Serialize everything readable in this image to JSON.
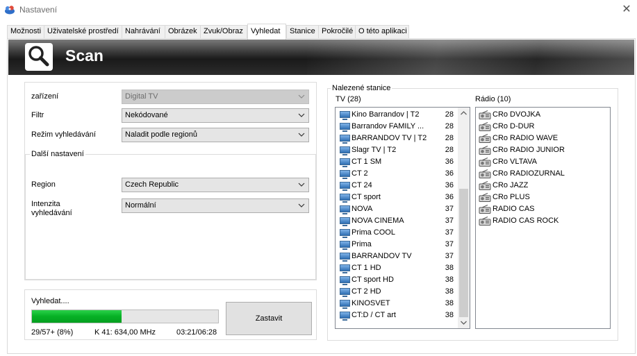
{
  "window": {
    "title": "Nastavení"
  },
  "tabs": [
    "Možnosti",
    "Uživatelské prostředí",
    "Nahrávání",
    "Obrázek",
    "Zvuk/Obraz",
    "Vyhledat",
    "Stanice",
    "Pokročilé",
    "O této aplikaci"
  ],
  "active_tab": "Vyhledat",
  "banner": {
    "title": "Scan",
    "icon": "search-icon"
  },
  "settings": {
    "device_label": "zařízení",
    "device_value": "Digital TV",
    "filter_label": "Filtr",
    "filter_value": "Nekódované",
    "mode_label": "Režim vyhledávání",
    "mode_value": "Naladit podle regionů"
  },
  "more_settings": {
    "title": "Další nastavení",
    "region_label": "Region",
    "region_value": "Czech Republic",
    "intensity_label_line1": "Intenzita",
    "intensity_label_line2": "vyhledávání",
    "intensity_value": "Normální"
  },
  "scan": {
    "status": "Vyhledat....",
    "progress_fraction": 0.48,
    "count_text": "29/57+ (8%)",
    "frequency_text": "K 41: 634,00 MHz",
    "time_text": "03:21/06:28",
    "stop_label": "Zastavit"
  },
  "found": {
    "title": "Nalezené stanice",
    "tv_header": "TV (28)",
    "radio_header": "Rádio (10)",
    "tv": [
      {
        "name": "Kino Barrandov | T2",
        "num": "28"
      },
      {
        "name": "Barrandov FAMILY ...",
        "num": "28"
      },
      {
        "name": "BARRANDOV TV | T2",
        "num": "28"
      },
      {
        "name": "Slagr TV | T2",
        "num": "28"
      },
      {
        "name": "CT 1 SM",
        "num": "36"
      },
      {
        "name": "CT 2",
        "num": "36"
      },
      {
        "name": "CT 24",
        "num": "36"
      },
      {
        "name": "CT sport",
        "num": "36"
      },
      {
        "name": " NOVA",
        "num": "37"
      },
      {
        "name": "NOVA CINEMA",
        "num": "37"
      },
      {
        "name": "Prima COOL",
        "num": "37"
      },
      {
        "name": "Prima",
        "num": "37"
      },
      {
        "name": "BARRANDOV TV",
        "num": "37"
      },
      {
        "name": "CT 1 HD",
        "num": "38"
      },
      {
        "name": "CT sport HD",
        "num": "38"
      },
      {
        "name": "CT 2 HD",
        "num": "38"
      },
      {
        "name": "KINOSVET",
        "num": "38"
      },
      {
        "name": "CT:D / CT art",
        "num": "38"
      }
    ],
    "radio": [
      "CRo DVOJKA",
      "CRo D-DUR",
      "CRo RADIO WAVE",
      "CRo RADIO JUNIOR",
      "CRo VLTAVA",
      "CRo RADIOZURNAL",
      "CRo JAZZ",
      "CRo PLUS",
      "RADIO CAS",
      "RADIO CAS ROCK"
    ]
  }
}
